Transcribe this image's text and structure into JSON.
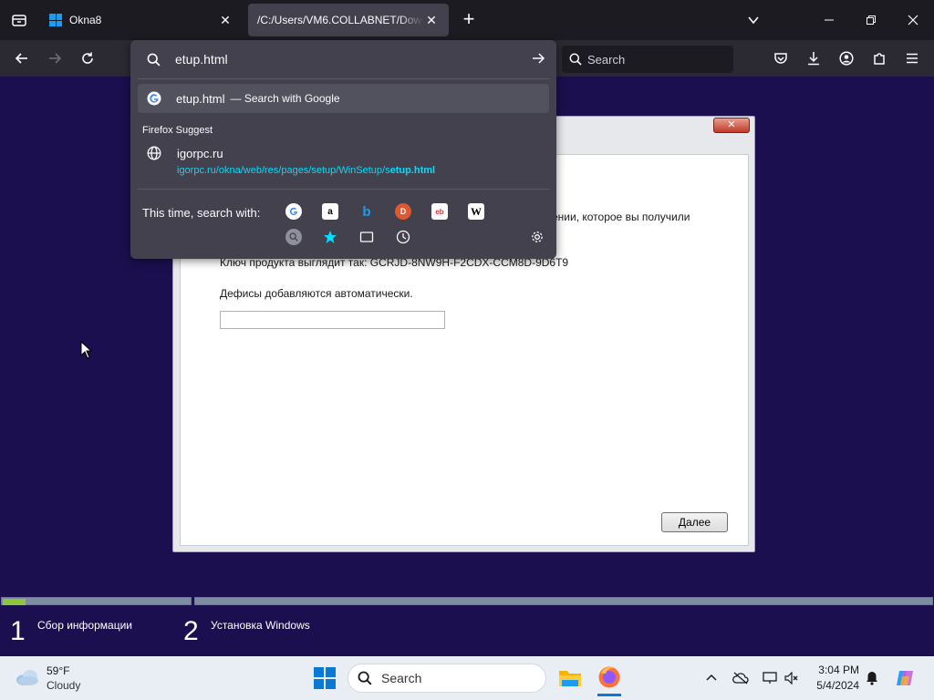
{
  "browser": {
    "tabs": [
      {
        "title": "Okna8",
        "active": false
      },
      {
        "title": "/C:/Users/VM6.COLLABNET/Downl",
        "active": true
      }
    ],
    "search_placeholder": "Search"
  },
  "urlbar": {
    "typed_text": "etup.html",
    "heuristic": {
      "text": "etup.html",
      "action": "— Search with Google"
    },
    "suggest_header": "Firefox Suggest",
    "suggestion": {
      "site": "igorpc.ru",
      "url_prefix": "igorpc.ru/okna/web/res/pages/setup/WinSetup/s",
      "url_match": "etup.html"
    },
    "engines_label": "This time, search with:",
    "engines": [
      "google-icon",
      "amazon-icon",
      "bing-icon",
      "duckduckgo-icon",
      "ebay-icon",
      "wikipedia-icon",
      "search-icon",
      "bookmarks-icon",
      "tabs-icon",
      "history-icon"
    ]
  },
  "setup": {
    "close_label": "✕",
    "line1": "дении, которое вы получили",
    "line2": "Ключ продукта выглядит так: GCRJD-8NW9H-F2CDX-CCM8D-9D6T9",
    "line3": "Дефисы добавляются автоматически.",
    "product_key_value": "",
    "next_label": "Далее"
  },
  "progress": {
    "step1_fraction": 0.12,
    "steps": [
      {
        "number": "1",
        "label": "Сбор информации"
      },
      {
        "number": "2",
        "label": "Установка Windows"
      }
    ]
  },
  "taskbar": {
    "weather_temp": "59°F",
    "weather_desc": "Cloudy",
    "search_label": "Search",
    "time": "3:04 PM",
    "date": "5/4/2024"
  }
}
